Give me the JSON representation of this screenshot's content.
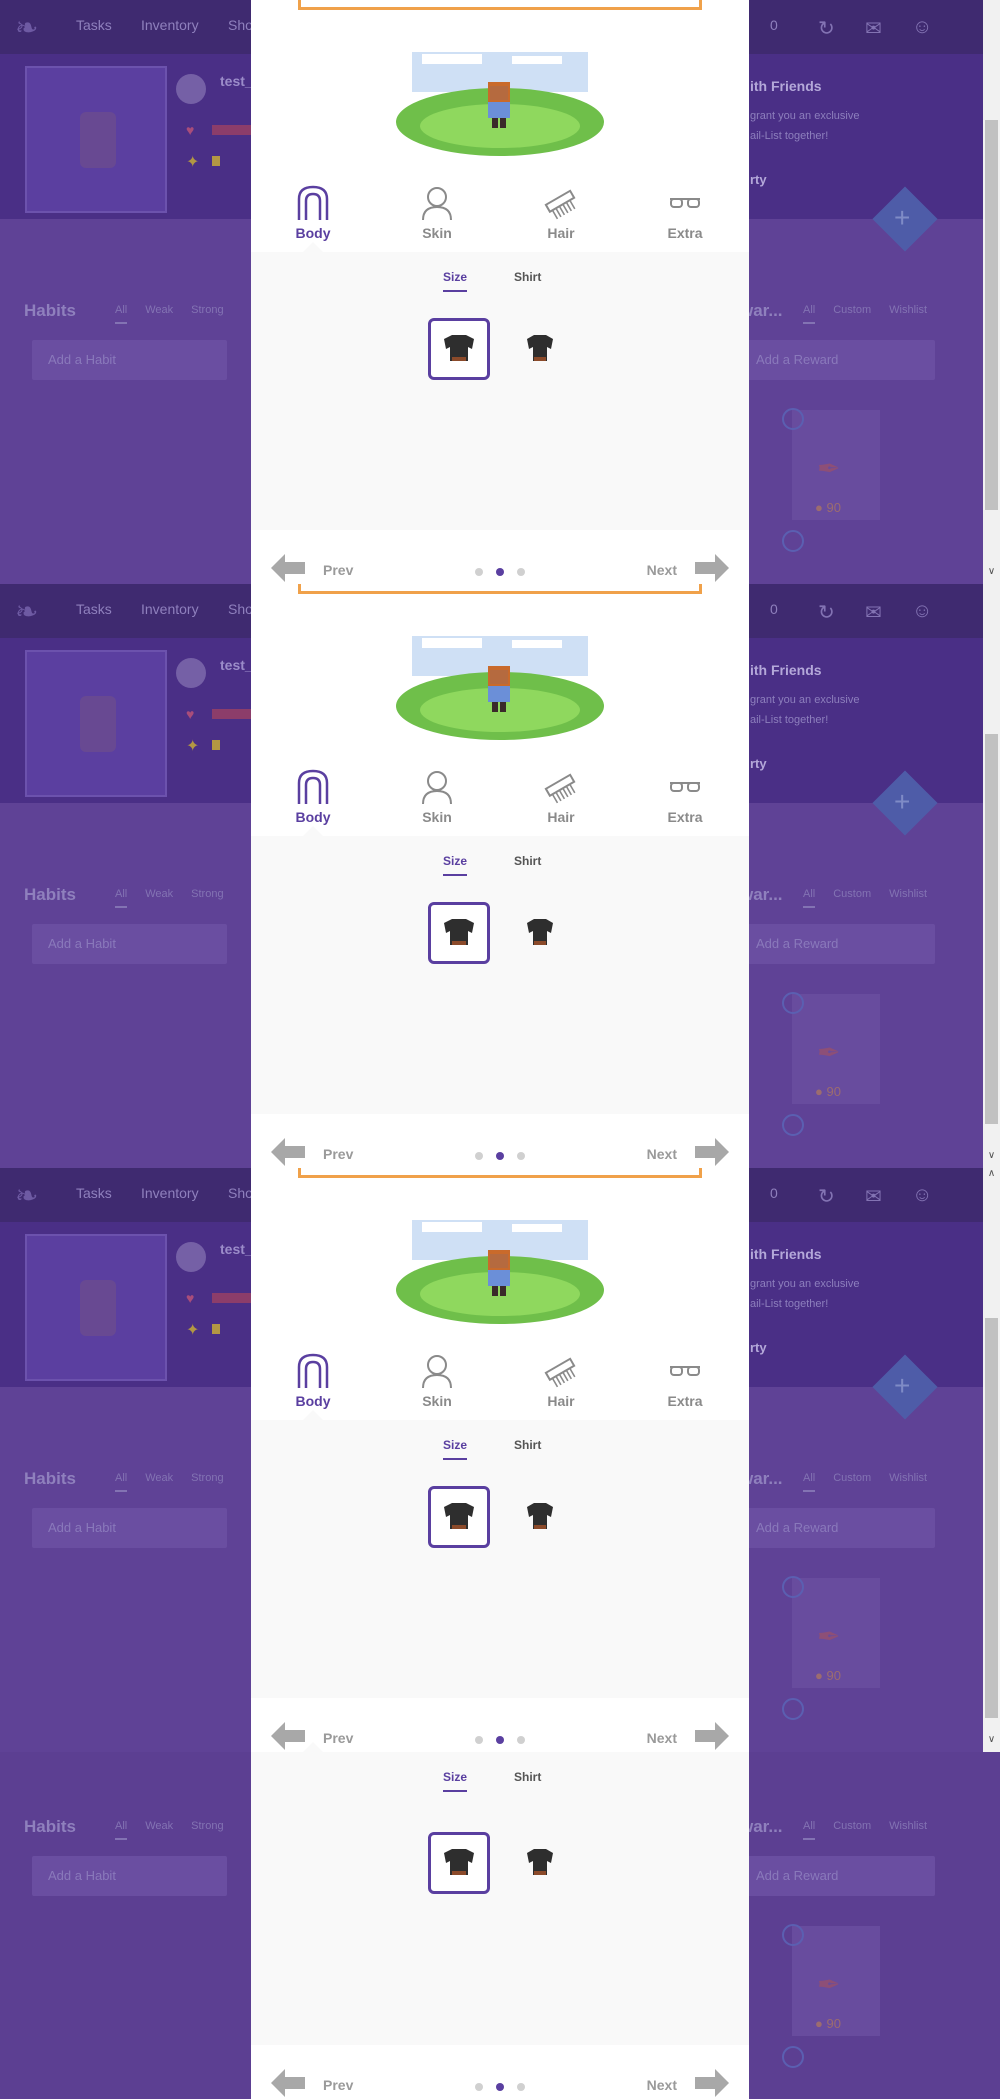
{
  "app": {
    "nav": [
      "Tasks",
      "Inventory",
      "Sho"
    ],
    "user_name": "test_",
    "gold": "0",
    "friends_title": "ith Friends",
    "friends_text_1": "grant you an exclusive",
    "friends_text_2": "ail-List together!",
    "friends_link": "rty",
    "habits_title": "Habits",
    "habit_filters": [
      "All",
      "Weak",
      "Strong"
    ],
    "add_habit_placeholder": "Add a Habit",
    "rewards_title": "war...",
    "reward_filters": [
      "All",
      "Custom",
      "Wishlist"
    ],
    "add_reward_placeholder": "Add a Reward",
    "reward_cost": "90"
  },
  "modal": {
    "categories": [
      {
        "label": "Body",
        "icon": "body-icon",
        "active": true
      },
      {
        "label": "Skin",
        "icon": "skin-icon",
        "active": false
      },
      {
        "label": "Hair",
        "icon": "hair-icon",
        "active": false
      },
      {
        "label": "Extra",
        "icon": "extra-icon",
        "active": false
      }
    ],
    "subtabs": [
      {
        "label": "Size",
        "active": true
      },
      {
        "label": "Shirt",
        "active": false
      }
    ],
    "options": [
      {
        "name": "broad-shirt-option",
        "selected": true
      },
      {
        "name": "slim-shirt-option",
        "selected": false
      }
    ],
    "prev_label": "Prev",
    "next_label": "Next",
    "page_count": 3,
    "current_page": 2
  },
  "colors": {
    "accent": "#5a3fa0",
    "orange": "#f0a14a",
    "overlay": "#5f4296"
  }
}
